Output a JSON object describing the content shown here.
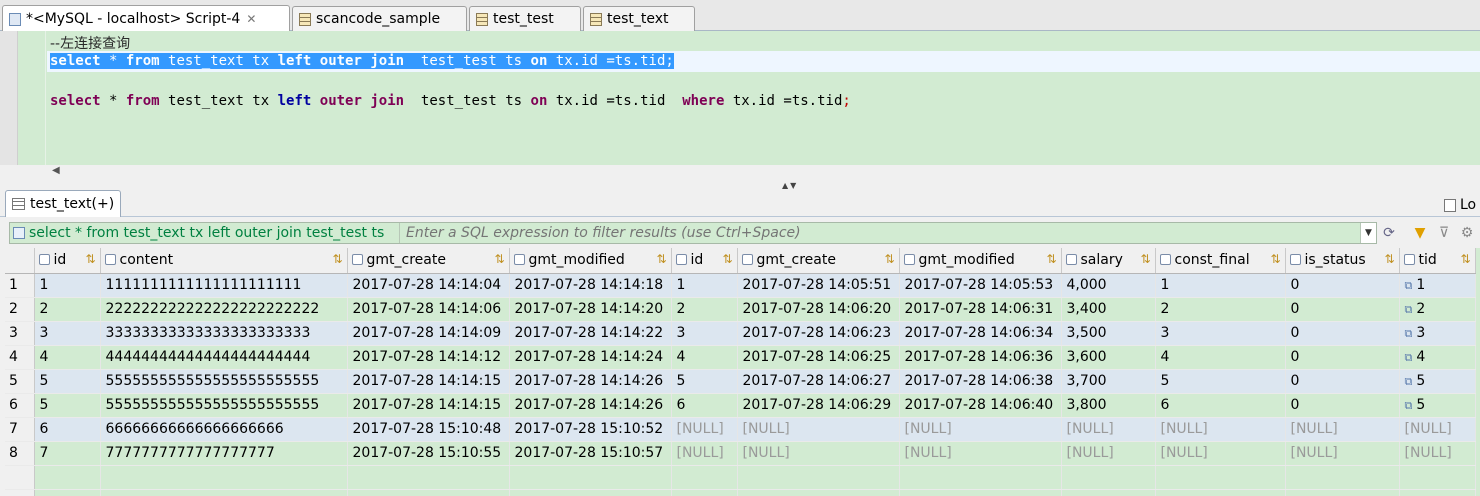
{
  "tabs": [
    {
      "label": "*<MySQL - localhost> Script-4",
      "icon": "sql-script-icon",
      "active": true,
      "closable": true
    },
    {
      "label": "scancode_sample",
      "icon": "table-icon",
      "active": false
    },
    {
      "label": "test_test",
      "icon": "table-icon",
      "active": false
    },
    {
      "label": "test_text",
      "icon": "table-icon",
      "active": false
    }
  ],
  "editor": {
    "comment": "--左连接查询",
    "line1": {
      "kw_select": "select",
      "star": " * ",
      "kw_from": "from",
      "t1": " test_text tx ",
      "kw_left": "left",
      "sp1": " ",
      "kw_outer": "outer",
      "sp2": " ",
      "kw_join": "join",
      "t2": "  test_test ts ",
      "kw_on": "on",
      "t3": " tx.id =ts.tid;"
    },
    "line2": {
      "kw_select": "select",
      "star": " * ",
      "kw_from": "from",
      "t1": " test_text tx ",
      "kw_left": "left",
      "sp1": " ",
      "kw_outer": "outer",
      "sp2": " ",
      "kw_join": "join",
      "t2": "  test_test ts ",
      "kw_on": "on",
      "t3": " tx.id =ts.tid  ",
      "kw_where": "where",
      "t4": " tx.id =ts.tid",
      "semi": ";"
    }
  },
  "results": {
    "tab_label": "test_text(+)",
    "log_label": "Lo",
    "filter_query": "select * from test_text tx left outer join test_test ts",
    "filter_placeholder": "Enter a SQL expression to filter results (use Ctrl+Space)",
    "columns": [
      "id",
      "content",
      "gmt_create",
      "gmt_modified",
      "id",
      "gmt_create",
      "gmt_modified",
      "salary",
      "const_final",
      "is_status",
      "tid"
    ],
    "rows": [
      [
        "1",
        "1",
        "1111111111111111111111",
        "2017-07-28 14:14:04",
        "2017-07-28 14:14:18",
        "1",
        "2017-07-28 14:05:51",
        "2017-07-28 14:05:53",
        "4,000",
        "1",
        "0",
        "1"
      ],
      [
        "2",
        "2",
        "222222222222222222222222",
        "2017-07-28 14:14:06",
        "2017-07-28 14:14:20",
        "2",
        "2017-07-28 14:06:20",
        "2017-07-28 14:06:31",
        "3,400",
        "2",
        "0",
        "2"
      ],
      [
        "3",
        "3",
        "33333333333333333333333",
        "2017-07-28 14:14:09",
        "2017-07-28 14:14:22",
        "3",
        "2017-07-28 14:06:23",
        "2017-07-28 14:06:34",
        "3,500",
        "3",
        "0",
        "3"
      ],
      [
        "4",
        "4",
        "44444444444444444444444",
        "2017-07-28 14:14:12",
        "2017-07-28 14:14:24",
        "4",
        "2017-07-28 14:06:25",
        "2017-07-28 14:06:36",
        "3,600",
        "4",
        "0",
        "4"
      ],
      [
        "5",
        "5",
        "555555555555555555555555",
        "2017-07-28 14:14:15",
        "2017-07-28 14:14:26",
        "5",
        "2017-07-28 14:06:27",
        "2017-07-28 14:06:38",
        "3,700",
        "5",
        "0",
        "5"
      ],
      [
        "6",
        "5",
        "555555555555555555555555",
        "2017-07-28 14:14:15",
        "2017-07-28 14:14:26",
        "6",
        "2017-07-28 14:06:29",
        "2017-07-28 14:06:40",
        "3,800",
        "6",
        "0",
        "5"
      ],
      [
        "7",
        "6",
        "66666666666666666666",
        "2017-07-28 15:10:48",
        "2017-07-28 15:10:52",
        "[NULL]",
        "[NULL]",
        "[NULL]",
        "[NULL]",
        "[NULL]",
        "[NULL]",
        "[NULL]"
      ],
      [
        "8",
        "7",
        "7777777777777777777",
        "2017-07-28 15:10:55",
        "2017-07-28 15:10:57",
        "[NULL]",
        "[NULL]",
        "[NULL]",
        "[NULL]",
        "[NULL]",
        "[NULL]",
        "[NULL]"
      ]
    ]
  },
  "colors": {
    "editor_bg": "#d2ebd2",
    "selection": "#3399ff",
    "keyword": "#7f0055",
    "keyword_blue": "#0000a0",
    "alt_row": "#dce6f0",
    "null_text": "#9a9a9a"
  }
}
